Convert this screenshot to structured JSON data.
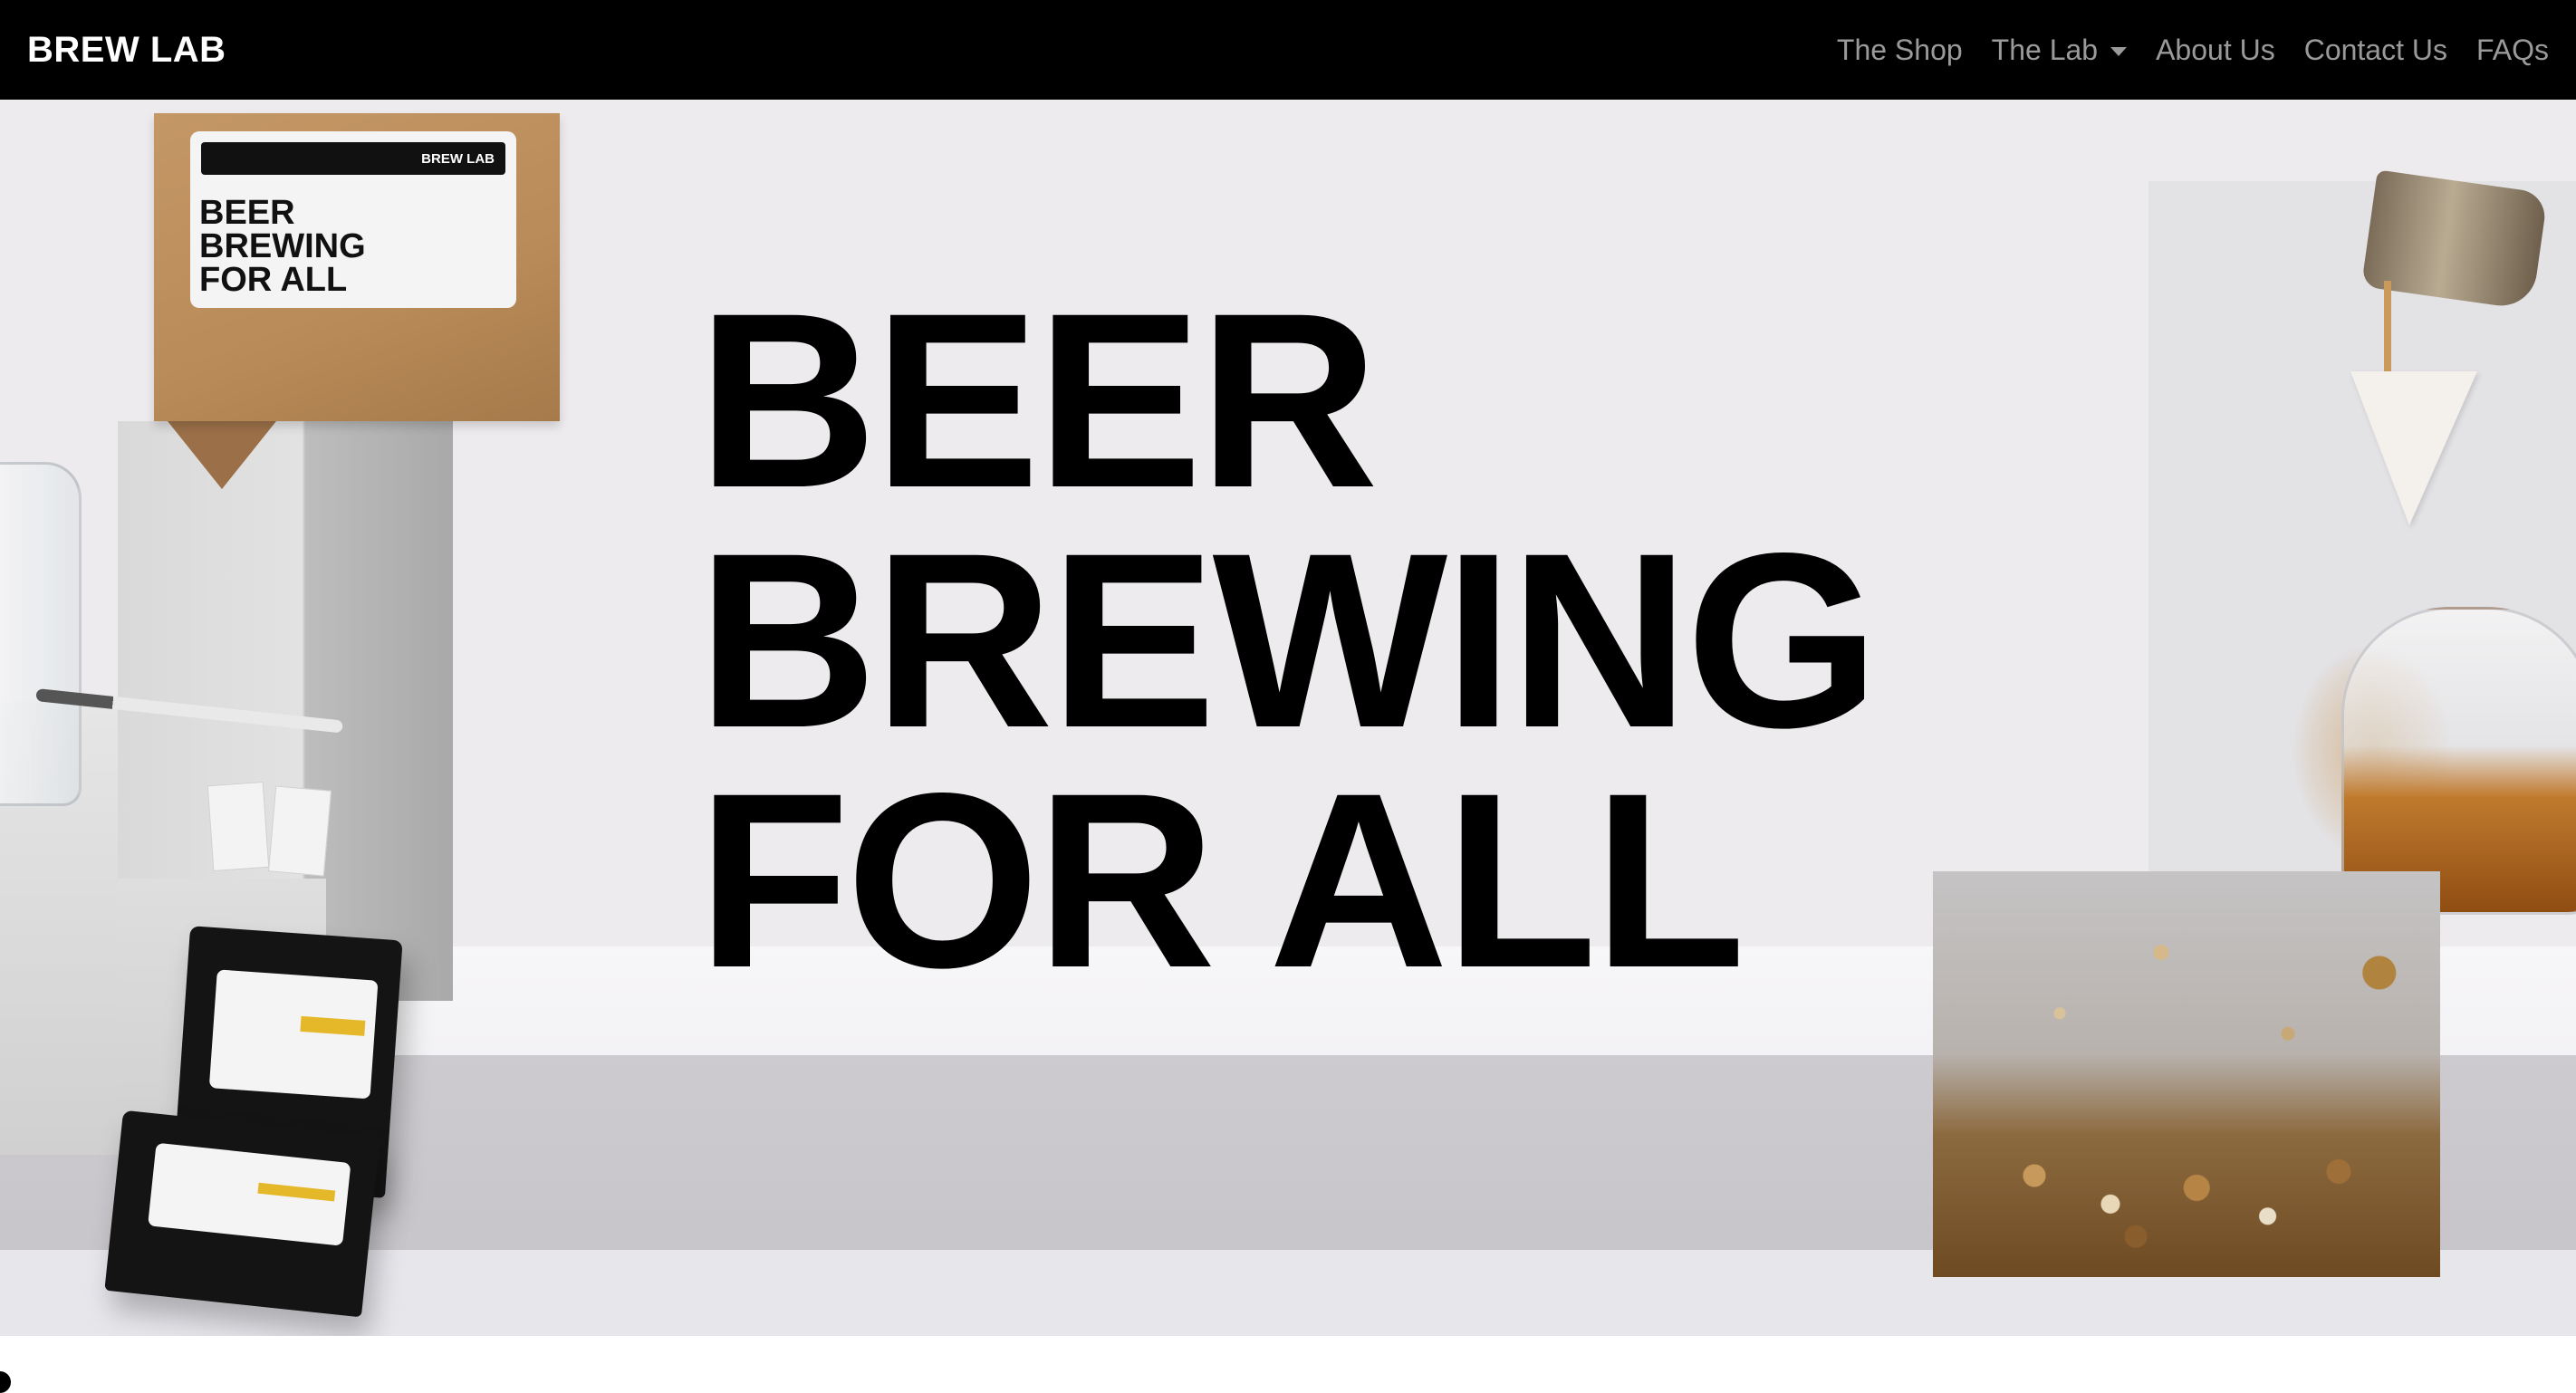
{
  "navbar": {
    "brand": "BREW LAB",
    "links": [
      {
        "label": "The Shop"
      },
      {
        "label": "The Lab",
        "has_dropdown": true
      },
      {
        "label": "About Us"
      },
      {
        "label": "Contact Us"
      },
      {
        "label": "FAQs"
      }
    ]
  },
  "hero": {
    "headline": [
      "BEER",
      "BREWING",
      "FOR ALL"
    ],
    "box_label": {
      "brand": "BREW LAB",
      "lines": [
        "BEER",
        "BREWING",
        "FOR ALL"
      ]
    }
  },
  "colors": {
    "navbar_bg": "#000000",
    "brand_text": "#ffffff",
    "nav_link": "#9a9a9a",
    "hero_bg": "#edebed",
    "headline": "#000000",
    "pouch_accent": "#e5b82a"
  },
  "icons": {
    "dropdown": "caret-down-icon"
  }
}
